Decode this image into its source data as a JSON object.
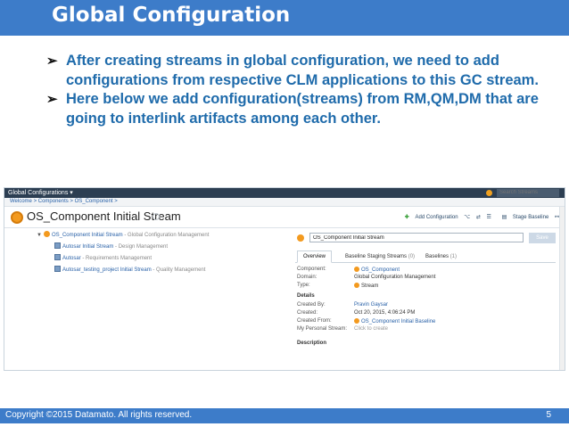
{
  "slide": {
    "title": "Global Configuration",
    "bullets": [
      "After creating streams in  global configuration, we need to add configurations from respective CLM applications to this GC stream.",
      "Here below we add configuration(streams) from RM,QM,DM that are going  to interlink artifacts among each other."
    ],
    "bullet_marker": "➢",
    "footer": "Copyright ©2015 Datamato. All rights reserved.",
    "page_number": "5",
    "colors": {
      "bar": "#3d7cc9",
      "bullet_text": "#1f6bab"
    }
  },
  "screenshot": {
    "app_name": "Global Configurations",
    "search_placeholder": "Search Streams",
    "breadcrumb": "Welcome > Components > OS_Component >",
    "page_title": "OS_Component Initial Stream",
    "actions": {
      "add_configuration": "Add Configuration",
      "stage_baseline": "Stage Baseline"
    },
    "tree": {
      "root": {
        "label": "OS_Component Initial Stream",
        "meta": "- Global Configuration Management"
      },
      "children": [
        {
          "label": "Autosar Initial Stream",
          "meta": "- Design Management"
        },
        {
          "label": "Autosar",
          "meta": "- Requirements Management"
        },
        {
          "label": "Autosar_testing_project Initial Stream",
          "meta": "- Quality Management"
        }
      ]
    },
    "panel": {
      "name_value": "OS_Component Initial Stream",
      "save_label": "Save",
      "tabs": [
        {
          "label": "Overview",
          "count": ""
        },
        {
          "label": "Baseline Staging Streams",
          "count": "(0)"
        },
        {
          "label": "Baselines",
          "count": "(1)"
        }
      ],
      "fields": {
        "component_label": "Component:",
        "component_value": "OS_Component",
        "domain_label": "Domain:",
        "domain_value": "Global Configuration Management",
        "type_label": "Type:",
        "type_value": "Stream"
      },
      "details": {
        "heading": "Details",
        "created_by_label": "Created By:",
        "created_by_value": "Pravin Gaysar",
        "created_label": "Created:",
        "created_value": "Oct 20, 2015, 4:06:24 PM",
        "created_from_label": "Created From:",
        "created_from_value": "OS_Component Initial Baseline",
        "personal_stream_label": "My Personal Stream:",
        "personal_stream_value": "Click to create",
        "description_heading": "Description"
      }
    }
  }
}
